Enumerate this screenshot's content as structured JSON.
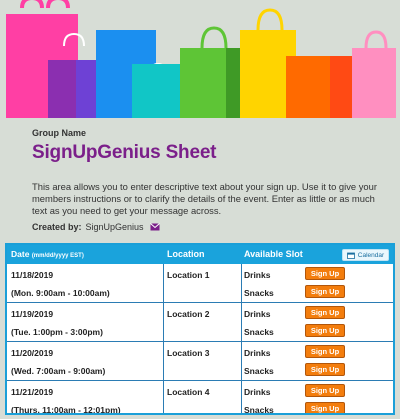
{
  "header": {
    "group_name": "Group Name",
    "title": "SignUpGenius Sheet",
    "description": "This area allows you to enter descriptive text about your sign up. Use it to give your members instructions or to clarify the details of the event. Enter as little or as much text as you need to get your message across.",
    "created_by_label": "Created by:",
    "created_by_name": "SignUpGenius",
    "created_by_icon": "envelope-icon"
  },
  "table": {
    "col_date_label": "Date",
    "col_date_format": "(mm/dd/yyyy EST)",
    "col_location_label": "Location",
    "col_slot_label": "Available Slot",
    "calendar_button_label": "Calendar",
    "calendar_icon": "calendar-icon",
    "signup_label": "Sign Up",
    "rows": [
      {
        "date": "11/18/2019",
        "time": "(Mon. 9:00am - 10:00am)",
        "location": "Location 1",
        "slots": [
          "Drinks",
          "Snacks"
        ]
      },
      {
        "date": "11/19/2019",
        "time": "(Tue. 1:00pm - 3:00pm)",
        "location": "Location 2",
        "slots": [
          "Drinks",
          "Snacks"
        ]
      },
      {
        "date": "11/20/2019",
        "time": "(Wed. 7:00am - 9:00am)",
        "location": "Location 3",
        "slots": [
          "Drinks",
          "Snacks"
        ]
      },
      {
        "date": "11/21/2019",
        "time": "(Thurs. 11:00am - 12:01pm)",
        "location": "Location 4",
        "slots": [
          "Drinks",
          "Snacks"
        ]
      }
    ]
  },
  "colors": {
    "title": "#7b1f8a",
    "table_header": "#1aa3dc",
    "signup_button": "#f37d0d",
    "background": "#d7ddd6"
  }
}
